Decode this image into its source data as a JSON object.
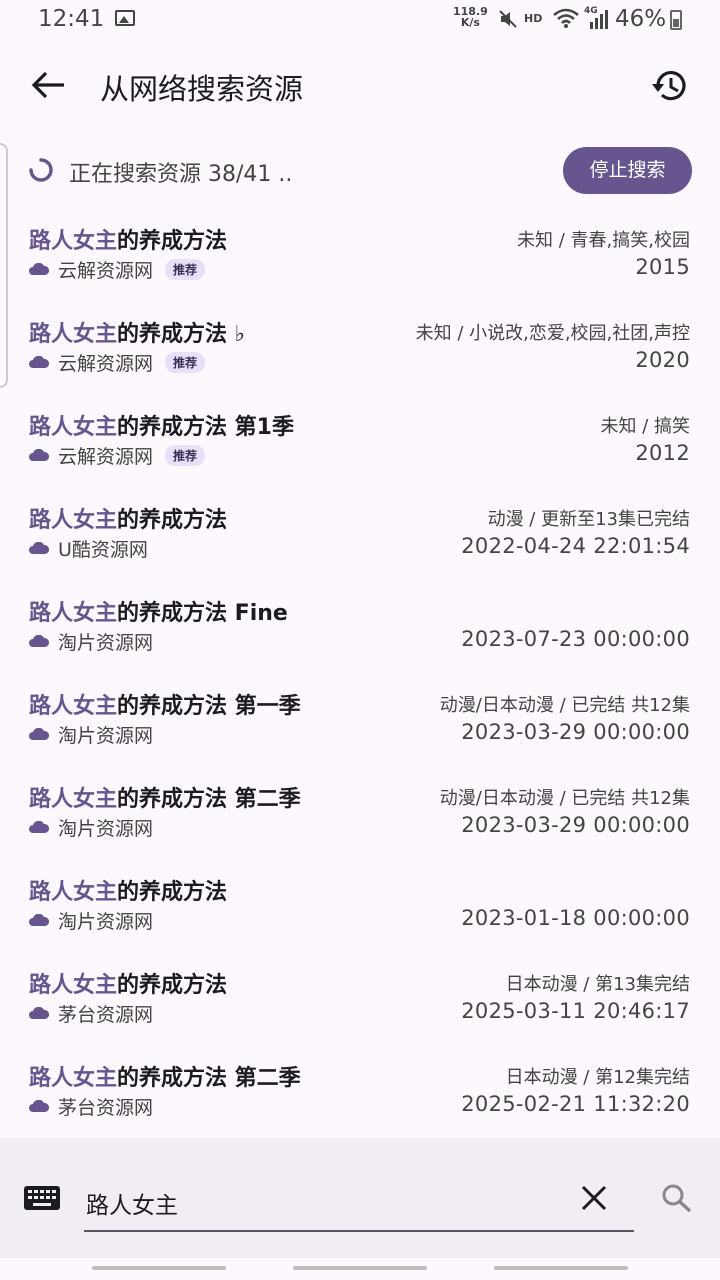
{
  "status_bar": {
    "time": "12:41",
    "net_speed_top": "118.9",
    "net_speed_bottom": "K/s",
    "hd": "HD",
    "net_type": "4G",
    "battery": "46%"
  },
  "app_bar": {
    "title": "从网络搜索资源"
  },
  "progress": {
    "text": "正在搜索资源 38/41 ..",
    "stop_label": "停止搜索"
  },
  "colors": {
    "accent": "#66558e",
    "badge_bg": "#e9dff8",
    "background": "#fdf7fe"
  },
  "results": [
    {
      "title_hl": "路人女主",
      "title_rest": "的养成方法",
      "source": "云解资源网",
      "badge": "推荐",
      "meta": "未知 / 青春,搞笑,校园",
      "date": "2015"
    },
    {
      "title_hl": "路人女主",
      "title_rest": "的养成方法 ♭",
      "source": "云解资源网",
      "badge": "推荐",
      "meta": "未知 / 小说改,恋爱,校园,社团,声控",
      "date": "2020"
    },
    {
      "title_hl": "路人女主",
      "title_rest": "的养成方法 第1季",
      "source": "云解资源网",
      "badge": "推荐",
      "meta": "未知 / 搞笑",
      "date": "2012"
    },
    {
      "title_hl": "路人女主",
      "title_rest": "的养成方法",
      "source": "U酷资源网",
      "badge": "",
      "meta": "动漫 / 更新至13集已完结",
      "date": "2022-04-24 22:01:54"
    },
    {
      "title_hl": "路人女主",
      "title_rest": "的养成方法 Fine",
      "source": "淘片资源网",
      "badge": "",
      "meta": "",
      "date": "2023-07-23 00:00:00"
    },
    {
      "title_hl": "路人女主",
      "title_rest": "的养成方法 第一季",
      "source": "淘片资源网",
      "badge": "",
      "meta": "动漫/日本动漫 / 已完结 共12集",
      "date": "2023-03-29 00:00:00"
    },
    {
      "title_hl": "路人女主",
      "title_rest": "的养成方法 第二季",
      "source": "淘片资源网",
      "badge": "",
      "meta": "动漫/日本动漫 / 已完结 共12集",
      "date": "2023-03-29 00:00:00"
    },
    {
      "title_hl": "路人女主",
      "title_rest": "的养成方法",
      "source": "淘片资源网",
      "badge": "",
      "meta": "",
      "date": "2023-01-18 00:00:00"
    },
    {
      "title_hl": "路人女主",
      "title_rest": "的养成方法",
      "source": "茅台资源网",
      "badge": "",
      "meta": "日本动漫 / 第13集完结",
      "date": "2025-03-11 20:46:17"
    },
    {
      "title_hl": "路人女主",
      "title_rest": "的养成方法 第二季",
      "source": "茅台资源网",
      "badge": "",
      "meta": "日本动漫 / 第12集完结",
      "date": "2025-02-21 11:32:20"
    }
  ],
  "search": {
    "value": "路人女主",
    "keyboard_icon": "keyboard-icon",
    "clear_icon": "close-icon",
    "search_icon": "search-icon"
  }
}
